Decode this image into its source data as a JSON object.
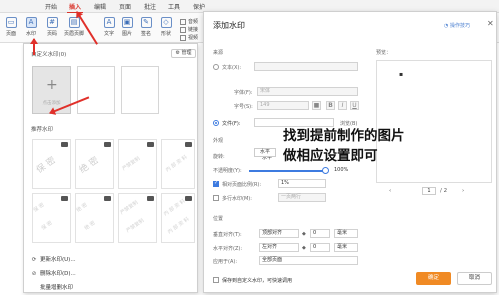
{
  "ribbon": {
    "tabs": [
      "开始",
      "插入",
      "编辑",
      "页面",
      "批注",
      "工具",
      "保护"
    ],
    "active_tab": "插入",
    "tools": [
      "页面",
      "水印",
      "页码",
      "页眉页脚",
      "文字",
      "图片",
      "签名",
      "形状"
    ],
    "mini_tools": [
      "音频",
      "链接",
      "视频"
    ]
  },
  "watermark_panel": {
    "custom_title": "自定义水印(0)",
    "manage_label": "管理",
    "add_tile_label": "点击添加",
    "recommended_title": "推荐水印",
    "tiles": [
      "保 密",
      "绝 密",
      "严禁复制",
      "内 部 资 料"
    ],
    "menu": [
      "更新水印(U)...",
      "删除水印(D)...",
      "批量增删水印"
    ]
  },
  "dialog": {
    "title": "添加水印",
    "help_label": "操作技巧",
    "source_label": "来源",
    "text_option": "文本(X):",
    "font_label": "字体(F):",
    "font_value": "宋体",
    "size_label": "字号(S):",
    "size_value": "149",
    "bold": "B",
    "italic": "I",
    "underline": "U",
    "file_option": "文件(F):",
    "browse_label": "浏览(B)",
    "appearance_label": "外观",
    "rotation_label": "旋转:",
    "rotation_value": "水平",
    "opacity_label": "不透明度(Y):",
    "opacity_value": "100%",
    "relative_scale_label": "相对页面比例(R):",
    "relative_scale_value": "1%",
    "multiline_label": "多行水印(M):",
    "multiline_value": "一页两行",
    "position_label": "位置",
    "vertical_label": "垂直对齐(T):",
    "vertical_value": "顶部对齐",
    "vertical_offset": "0",
    "horizontal_label": "水平对齐(Z):",
    "horizontal_value": "左对齐",
    "horizontal_offset": "0",
    "unit": "毫米",
    "apply_label": "应用于(A):",
    "apply_value": "全部页面",
    "save_custom_label": "保存到自定义水印，可快速调用",
    "preview_label": "预览：",
    "page_current": "1",
    "page_total": "/ 2",
    "ok_label": "确定",
    "cancel_label": "取消"
  },
  "annotation": {
    "line1": "找到提前制作的图片",
    "line2": "做相应设置即可"
  },
  "colors": {
    "accent_red": "#d9342b",
    "arrow_red": "#e0302a",
    "ok_orange": "#f08a24",
    "radio_blue": "#3d7be0"
  }
}
